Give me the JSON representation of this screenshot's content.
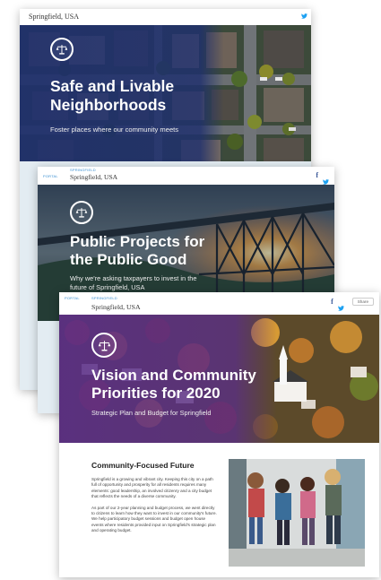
{
  "cards": [
    {
      "site_name": "Springfield, USA",
      "title_line1": "Safe and Livable",
      "title_line2": "Neighborhoods",
      "subtitle": "Foster places where our community meets"
    },
    {
      "crumbs": [
        "PORTAL",
        "SPRINGFIELD"
      ],
      "site_name": "Springfield, USA",
      "title_line1": "Public Projects for",
      "title_line2": "the Public Good",
      "subtitle_line1": "Why we're asking taxpayers to invest in the",
      "subtitle_line2": "future of Springfield, USA",
      "share_icons": [
        "facebook-icon",
        "twitter-icon"
      ]
    },
    {
      "crumbs": [
        "PORTAL",
        "SPRINGFIELD"
      ],
      "site_name": "Springfield, USA",
      "title_line1": "Vision and Community",
      "title_line2": "Priorities for 2020",
      "subtitle": "Strategic Plan and Budget for Springfield",
      "share_button": "Share",
      "share_icons": [
        "facebook-icon",
        "twitter-icon"
      ],
      "section_heading": "Community-Focused Future",
      "paragraph1": "Springfield is a growing and vibrant city. Keeping this city on a path full of opportunity and prosperity for all residents requires many elements: good leadership, an involved citizenry and a city budget that reflects the needs of a diverse community.",
      "paragraph2": "As part of our 2-year planning and budget process, we went directly to citizens to learn how they want to invest in our community's future. We help participatory budget sessions and budget open house events where residents provided input on Springfield's strategic plan and operating budget."
    }
  ],
  "colors": {
    "accent_blue": "#3a8fd1",
    "facebook": "#3b5998",
    "twitter": "#1da1f2",
    "overlay_navy": "#1e2f6e",
    "overlay_purple": "#5a2d8a"
  }
}
